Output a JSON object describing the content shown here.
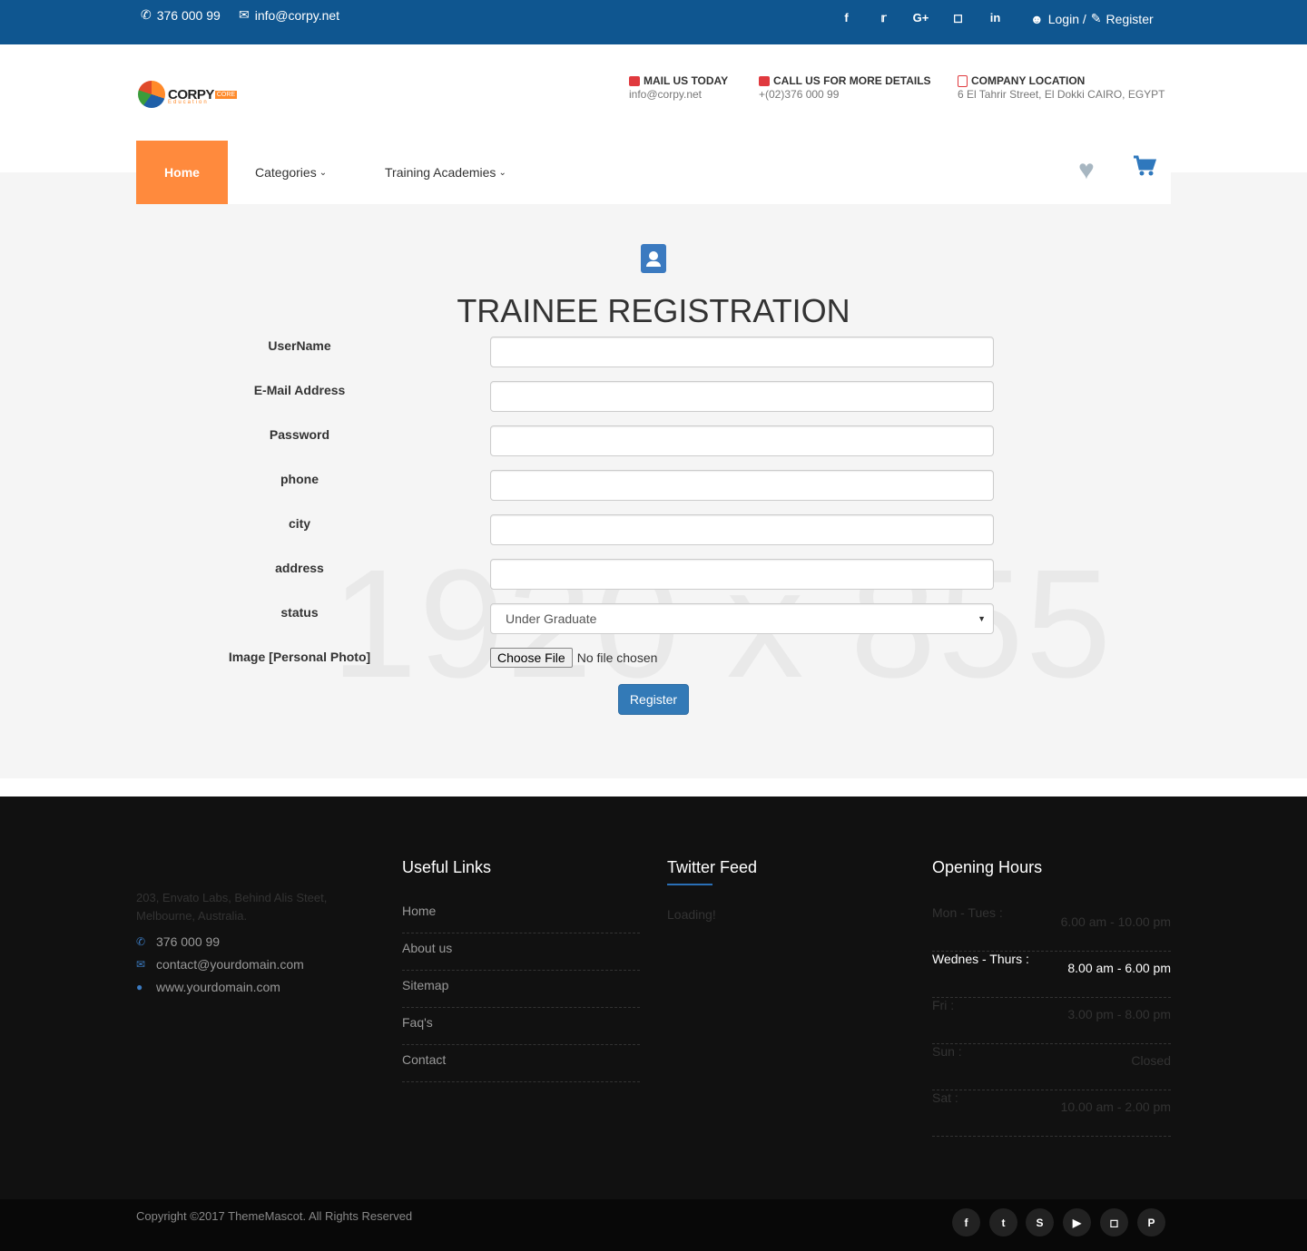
{
  "topbar": {
    "phone": "376 000 99",
    "email": "info@corpy.net",
    "socials": [
      "facebook",
      "twitter",
      "google-plus",
      "instagram",
      "linkedin"
    ],
    "login": "Login /",
    "register": "Register"
  },
  "header": {
    "logo": {
      "name": "CORPY",
      "badge": "CORE",
      "tagline": "Education"
    },
    "mail": {
      "title": "MAIL US TODAY",
      "value": "info@corpy.net"
    },
    "call": {
      "title": "CALL US FOR MORE DETAILS",
      "value": "+(02)376 000 99"
    },
    "location": {
      "title": "COMPANY LOCATION",
      "value": "6 El Tahrir Street, El Dokki CAIRO, EGYPT"
    }
  },
  "nav": {
    "home": "Home",
    "categories": "Categories",
    "academies": "Training Academies"
  },
  "main": {
    "watermark": "1920 x 855",
    "title": "TRAINEE REGISTRATION",
    "fields": {
      "username": "UserName",
      "email": "E-Mail Address",
      "password": "Password",
      "phone": "phone",
      "city": "city",
      "address": "address",
      "status": "status",
      "image": "Image [Personal Photo]"
    },
    "status_value": "Under Graduate",
    "file_button": "Choose File",
    "file_status": "No file chosen",
    "submit": "Register"
  },
  "footer": {
    "address": "203, Envato Labs, Behind Alis Steet, Melbourne, Australia.",
    "phone": "376 000 99",
    "email": "contact@yourdomain.com",
    "website": "www.yourdomain.com",
    "useful_title": "Useful Links",
    "links": [
      "Home",
      "About us",
      "Sitemap",
      "Faq's",
      "Contact"
    ],
    "twitter_title": "Twitter Feed",
    "twitter_status": "Loading!",
    "hours_title": "Opening Hours",
    "hours": [
      {
        "day": "Mon - Tues :",
        "time": "6.00 am - 10.00 pm"
      },
      {
        "day": "Wednes - Thurs :",
        "time": "8.00 am - 6.00 pm"
      },
      {
        "day": "Fri :",
        "time": "3.00 pm - 8.00 pm"
      },
      {
        "day": "Sun :",
        "time": "Closed"
      },
      {
        "day": "Sat :",
        "time": "10.00 am - 2.00 pm"
      }
    ],
    "copyright": "Copyright ©2017 ThemeMascot. All Rights Reserved"
  },
  "colors": {
    "topbar": "#0f5690",
    "accent": "#ff8a3d",
    "button": "#337ab7",
    "footer": "#111111"
  }
}
